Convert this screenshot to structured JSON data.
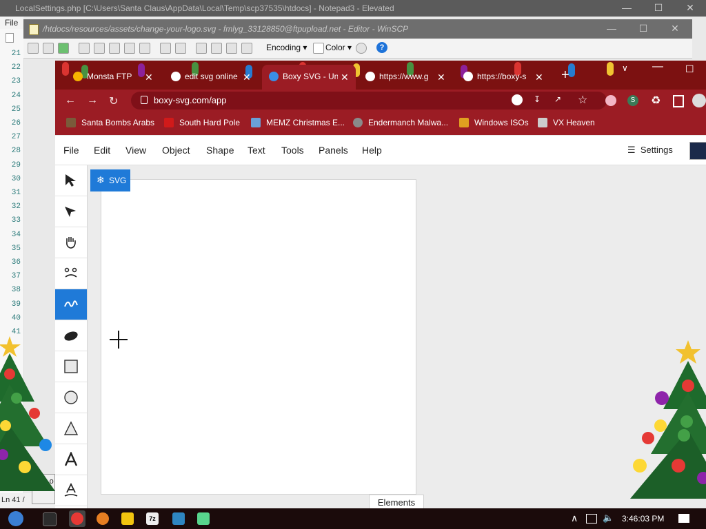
{
  "notepad": {
    "title": "LocalSettings.php [C:\\Users\\Santa Claus\\AppData\\Local\\Temp\\scp37535\\htdocs] - Notepad3 - Elevated",
    "menu_file": "File",
    "line_numbers": [
      "21",
      "22",
      "23",
      "24",
      "25",
      "26",
      "27",
      "28",
      "29",
      "30",
      "31",
      "32",
      "33",
      "34",
      "35",
      "36",
      "37",
      "38",
      "39",
      "40",
      "41"
    ],
    "status": "Ln 41 /",
    "status2": "0 B o"
  },
  "winscp": {
    "title": "/htdocs/resources/assets/change-your-logo.svg - fmlyg_33128850@ftpupload.net - Editor - WinSCP",
    "encoding_label": "Encoding",
    "color_label": "Color"
  },
  "chrome": {
    "tabs": [
      {
        "label": "Monsta FTP"
      },
      {
        "label": "edit svg online"
      },
      {
        "label": "Boxy SVG - Un"
      },
      {
        "label": "https://www.g"
      },
      {
        "label": "https://boxy-s"
      }
    ],
    "url": "boxy-svg.com/app",
    "profile_letter": "S",
    "bookmarks": [
      {
        "label": "Santa Bombs Arabs",
        "color": "#7a5a3a"
      },
      {
        "label": "South Hard Pole",
        "color": "#d11a1a"
      },
      {
        "label": "MEMZ Christmas E...",
        "color": "#6aa0d8"
      },
      {
        "label": "Endermanch Malwa...",
        "color": "#8a8a8a"
      },
      {
        "label": "Windows ISOs",
        "color": "#e0a020"
      },
      {
        "label": "VX Heaven",
        "color": "#cccccc"
      }
    ]
  },
  "boxy": {
    "menu": [
      "File",
      "Edit",
      "View",
      "Object",
      "Shape",
      "Text",
      "Tools",
      "Panels",
      "Help"
    ],
    "settings_label": "Settings",
    "badge": "SVG",
    "elements_tab": "Elements",
    "accent": "#1f7ad8"
  },
  "taskbar": {
    "clock": "3:46:03 PM"
  }
}
